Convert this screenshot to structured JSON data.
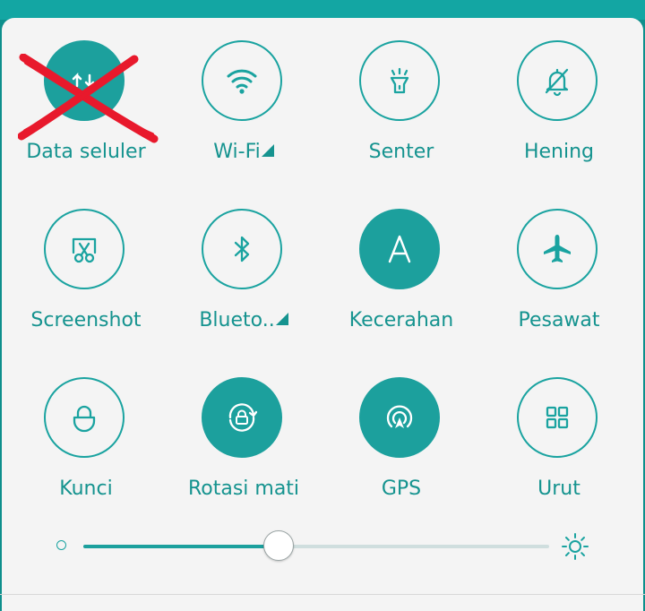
{
  "colors": {
    "accent": "#1ca09d",
    "label": "#15938f",
    "panel": "#f4f4f4",
    "header": "#13a6a3",
    "cross": "#e8192c"
  },
  "tiles": [
    {
      "label": "Data seluler",
      "icon": "mobile-data-icon",
      "active": true,
      "crossed_out": true
    },
    {
      "label": "Wi-Fi",
      "icon": "wifi-icon",
      "active": false,
      "has_menu": true
    },
    {
      "label": "Senter",
      "icon": "flashlight-icon",
      "active": false
    },
    {
      "label": "Hening",
      "icon": "bell-off-icon",
      "active": false
    },
    {
      "label": "Screenshot",
      "icon": "scissors-icon",
      "active": false
    },
    {
      "label": "Blueto..",
      "icon": "bluetooth-icon",
      "active": false,
      "has_menu": true
    },
    {
      "label": "Kecerahan",
      "icon": "auto-brightness-icon",
      "active": true
    },
    {
      "label": "Pesawat",
      "icon": "airplane-icon",
      "active": false
    },
    {
      "label": "Kunci",
      "icon": "lock-icon",
      "active": false
    },
    {
      "label": "Rotasi mati",
      "icon": "rotation-lock-icon",
      "active": true
    },
    {
      "label": "GPS",
      "icon": "gps-icon",
      "active": true
    },
    {
      "label": "Urut",
      "icon": "grid-icon",
      "active": false
    }
  ],
  "brightness": {
    "level": 0.42,
    "min_icon": "brightness-low-icon",
    "max_icon": "brightness-high-icon"
  }
}
